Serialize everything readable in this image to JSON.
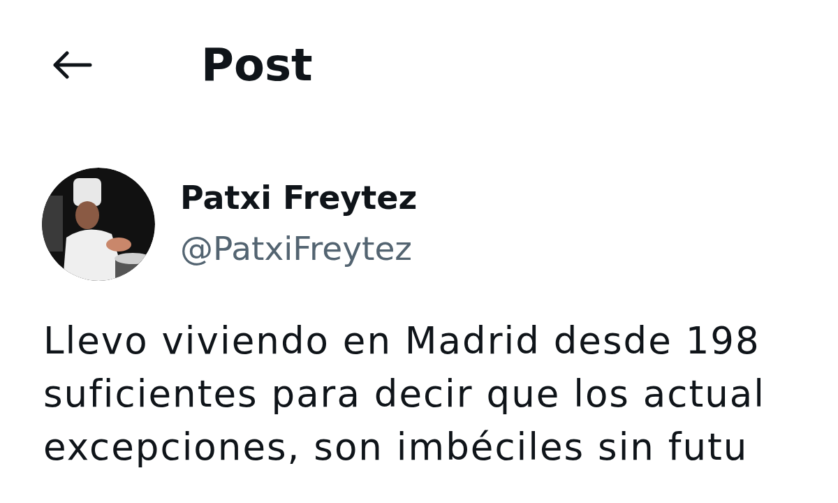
{
  "header": {
    "title": "Post"
  },
  "post": {
    "author": {
      "name": "Patxi Freytez",
      "handle": "@PatxiFreytez"
    },
    "lines": [
      "Llevo viviendo en Madrid desde 198",
      "suficientes para decir que los actual",
      "excepciones, son imbéciles sin futu"
    ]
  }
}
